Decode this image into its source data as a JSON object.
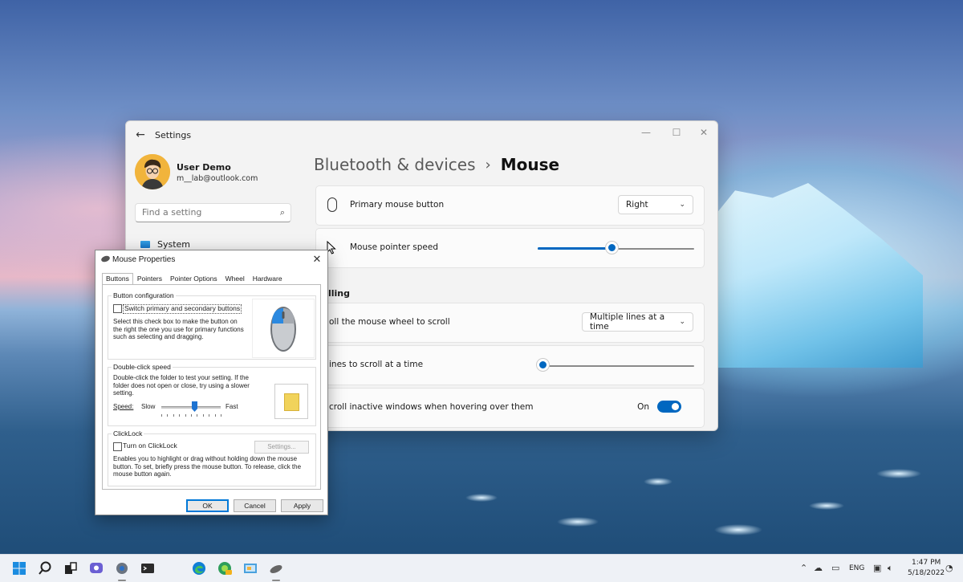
{
  "settings": {
    "app_title": "Settings",
    "user": {
      "name": "User Demo",
      "email": "m__lab@outlook.com"
    },
    "search_placeholder": "Find a setting",
    "nav_items": [
      {
        "label": "System",
        "icon": "monitor-icon"
      }
    ],
    "breadcrumb": {
      "parent": "Bluetooth & devices",
      "separator": "›",
      "current": "Mouse"
    },
    "primary_button": {
      "label": "Primary mouse button",
      "value": "Right"
    },
    "pointer_speed": {
      "label": "Mouse pointer speed",
      "value": 0.47
    },
    "scrolling_header": "lling",
    "scroll_mode": {
      "label": "oll the mouse wheel to scroll",
      "value": "Multiple lines at a time"
    },
    "lines_to_scroll": {
      "label": "ines to scroll at a time",
      "value": 0.03
    },
    "inactive_scroll": {
      "label": "croll inactive windows when hovering over them",
      "state_label": "On",
      "enabled": true
    },
    "accent_color": "#0067c0"
  },
  "mouse_properties": {
    "title": "Mouse Properties",
    "close": "✕",
    "tabs": [
      "Buttons",
      "Pointers",
      "Pointer Options",
      "Wheel",
      "Hardware"
    ],
    "active_tab": "Buttons",
    "button_config": {
      "title": "Button configuration",
      "checkbox_label": "Switch primary and secondary buttons",
      "checked": false,
      "description": "Select this check box to make the button on the right the one you use for primary functions such as selecting and dragging."
    },
    "double_click": {
      "title": "Double-click speed",
      "description": "Double-click the folder to test your setting. If the folder does not open or close, try using a slower setting.",
      "speed_label": "Speed:",
      "slow_label": "Slow",
      "fast_label": "Fast",
      "value": 0.56
    },
    "clicklock": {
      "title": "ClickLock",
      "checkbox_label": "Turn on ClickLock",
      "checked": false,
      "settings_button": "Settings...",
      "description": "Enables you to highlight or drag without holding down the mouse button. To set, briefly press the mouse button. To release, click the mouse button again."
    },
    "buttons": {
      "ok": "OK",
      "cancel": "Cancel",
      "apply": "Apply"
    }
  },
  "taskbar": {
    "apps": [
      "start-icon",
      "search-icon",
      "task-view-icon",
      "chat-icon",
      "settings-icon",
      "terminal-icon",
      "edge-icon",
      "edge-canary-icon",
      "control-panel-icon",
      "mouse-icon"
    ],
    "language": "ENG",
    "time": "1:47 PM",
    "date": "5/18/2022"
  }
}
